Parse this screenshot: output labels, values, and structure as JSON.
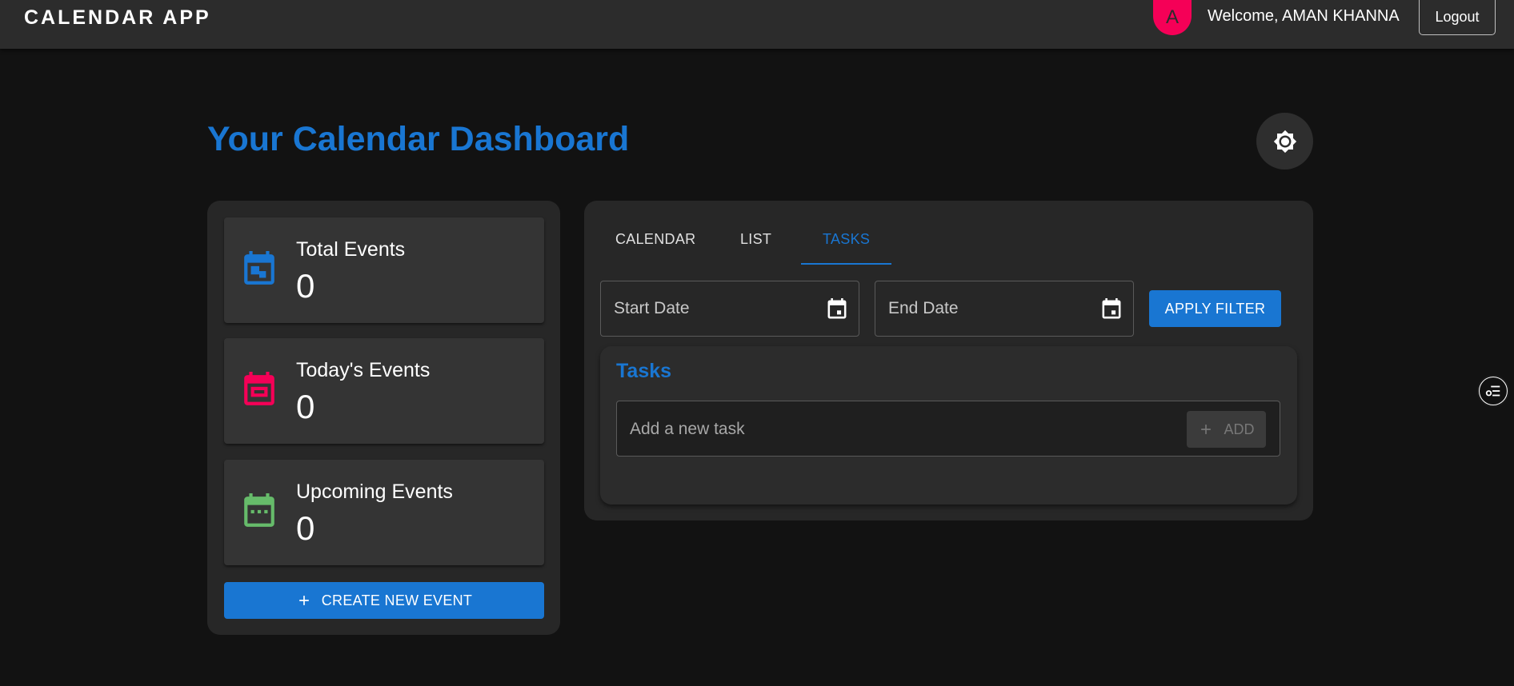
{
  "appbar": {
    "brand": "CALENDAR APP",
    "avatar_letter": "A",
    "welcome": "Welcome, AMAN KHANNA",
    "logout_label": "Logout"
  },
  "page": {
    "title": "Your Calendar Dashboard"
  },
  "stats": [
    {
      "label": "Total Events",
      "value": "0",
      "color": "#1976d2"
    },
    {
      "label": "Today's Events",
      "value": "0",
      "color": "#f50057"
    },
    {
      "label": "Upcoming Events",
      "value": "0",
      "color": "#66bb6a"
    }
  ],
  "create_button_label": "CREATE NEW EVENT",
  "tabs": [
    {
      "label": "CALENDAR",
      "active": false
    },
    {
      "label": "LIST",
      "active": false
    },
    {
      "label": "TASKS",
      "active": true
    }
  ],
  "filter": {
    "start_placeholder": "Start Date",
    "end_placeholder": "End Date",
    "apply_label": "APPLY FILTER"
  },
  "tasks": {
    "title": "Tasks",
    "input_placeholder": "Add a new task",
    "add_label": "ADD"
  },
  "colors": {
    "accent": "#1976d2",
    "secondary": "#f50057",
    "success": "#66bb6a",
    "background": "#121212",
    "surface": "#272727"
  }
}
